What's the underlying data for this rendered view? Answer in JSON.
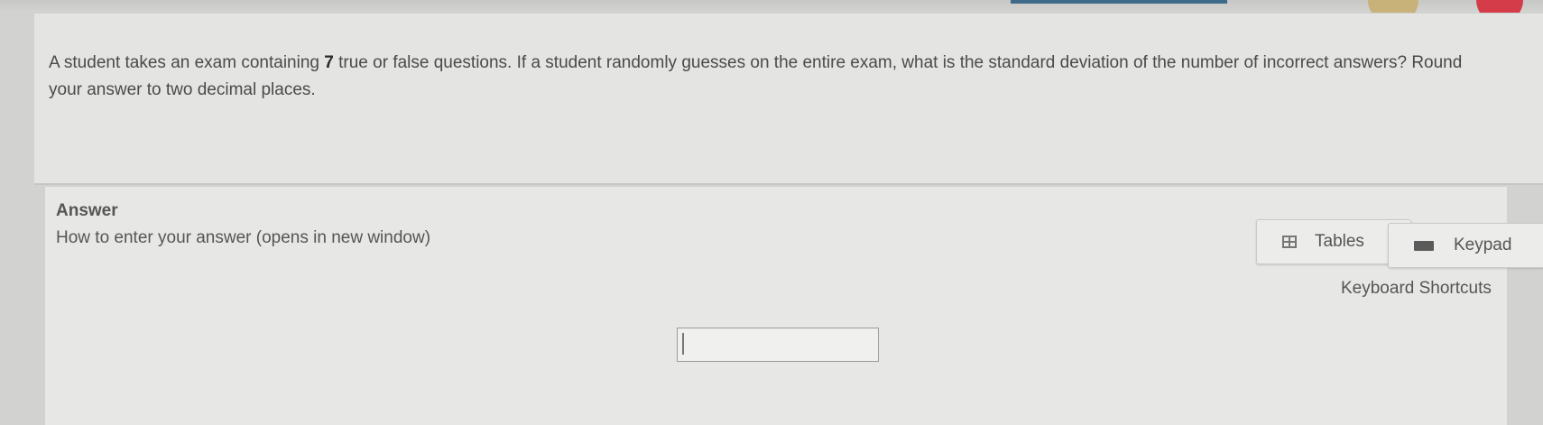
{
  "question": {
    "text_before": "A student takes an exam containing ",
    "number": "7",
    "text_after": " true or false questions.  If a student randomly guesses on the entire exam, what is the standard deviation of the number of incorrect answers?  Round your answer to two decimal places."
  },
  "answer": {
    "heading": "Answer",
    "how_to_link": "How to enter your answer (opens in new window)",
    "input_value": "",
    "input_placeholder": ""
  },
  "tools": {
    "tables_label": "Tables",
    "keypad_label": "Keypad",
    "shortcuts_label": "Keyboard Shortcuts"
  },
  "colors": {
    "page_background": "#d2d2d0",
    "card_background": "#e4e4e2",
    "text": "#4a4a4a",
    "heart_badge": "#d43c4a",
    "top_bar_accent": "#3f6b8a"
  }
}
